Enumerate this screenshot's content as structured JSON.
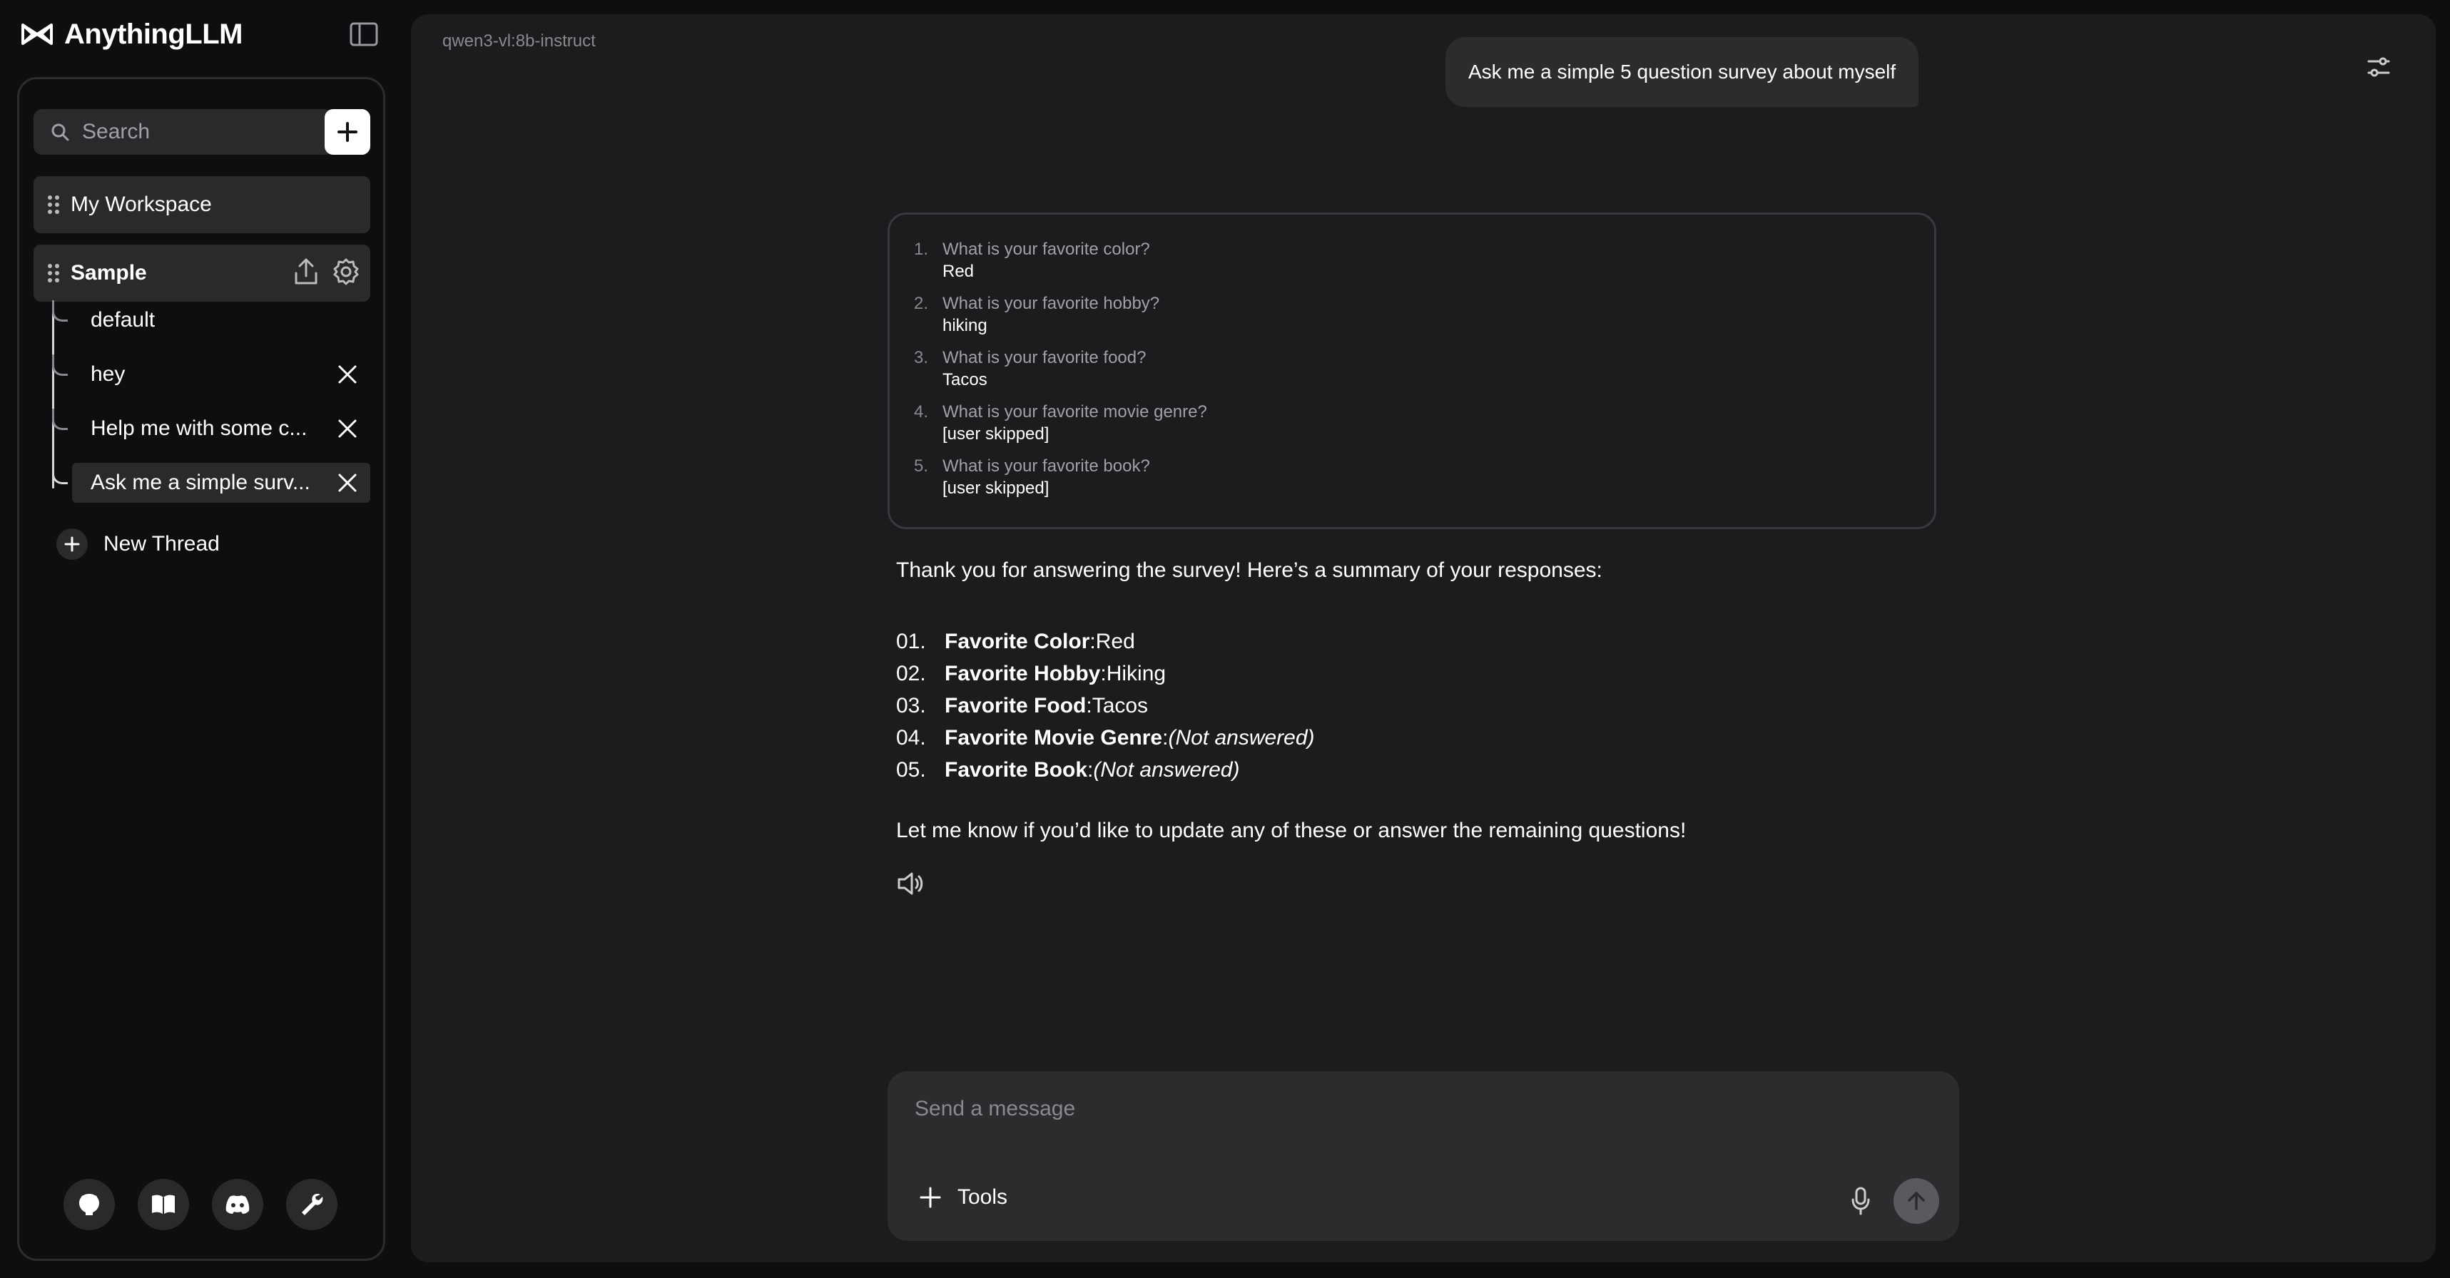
{
  "app": {
    "brand": "AnythingLLM"
  },
  "sidebar": {
    "search_placeholder": "Search",
    "workspaces": [
      {
        "label": "My Workspace"
      },
      {
        "label": "Sample"
      }
    ],
    "threads": [
      {
        "label": "default"
      },
      {
        "label": "hey"
      },
      {
        "label": "Help me with some c..."
      },
      {
        "label": "Ask me a simple surv..."
      }
    ],
    "new_thread_label": "New Thread",
    "footer_icons": [
      "github-icon",
      "book-icon",
      "discord-icon",
      "wrench-icon"
    ]
  },
  "main": {
    "model_name": "qwen3-vl:8b-instruct",
    "user_message": "Ask me a simple 5 question survey about myself",
    "survey": [
      {
        "num": "1.",
        "question": "What is your favorite color?",
        "answer": "Red"
      },
      {
        "num": "2.",
        "question": "What is your favorite hobby?",
        "answer": "hiking"
      },
      {
        "num": "3.",
        "question": "What is your favorite food?",
        "answer": "Tacos"
      },
      {
        "num": "4.",
        "question": "What is your favorite movie genre?",
        "answer": "[user skipped]"
      },
      {
        "num": "5.",
        "question": "What is your favorite book?",
        "answer": "[user skipped]"
      }
    ],
    "reply_intro": "Thank you for answering the survey! Here’s a summary of your responses:",
    "summary": [
      {
        "idx": "01.",
        "key": "Favorite Color",
        "sep": ": ",
        "value": "Red"
      },
      {
        "idx": "02.",
        "key": "Favorite Hobby",
        "sep": ": ",
        "value": "Hiking"
      },
      {
        "idx": "03.",
        "key": "Favorite Food",
        "sep": ": ",
        "value": "Tacos"
      },
      {
        "idx": "04.",
        "key": "Favorite Movie Genre",
        "sep": ": ",
        "value": "(Not answered)"
      },
      {
        "idx": "05.",
        "key": "Favorite Book",
        "sep": ": ",
        "value": "(Not answered)"
      }
    ],
    "reply_outro": "Let me know if you’d like to update any of these or answer the remaining questions!"
  },
  "composer": {
    "placeholder": "Send a message",
    "tools_label": "Tools"
  }
}
